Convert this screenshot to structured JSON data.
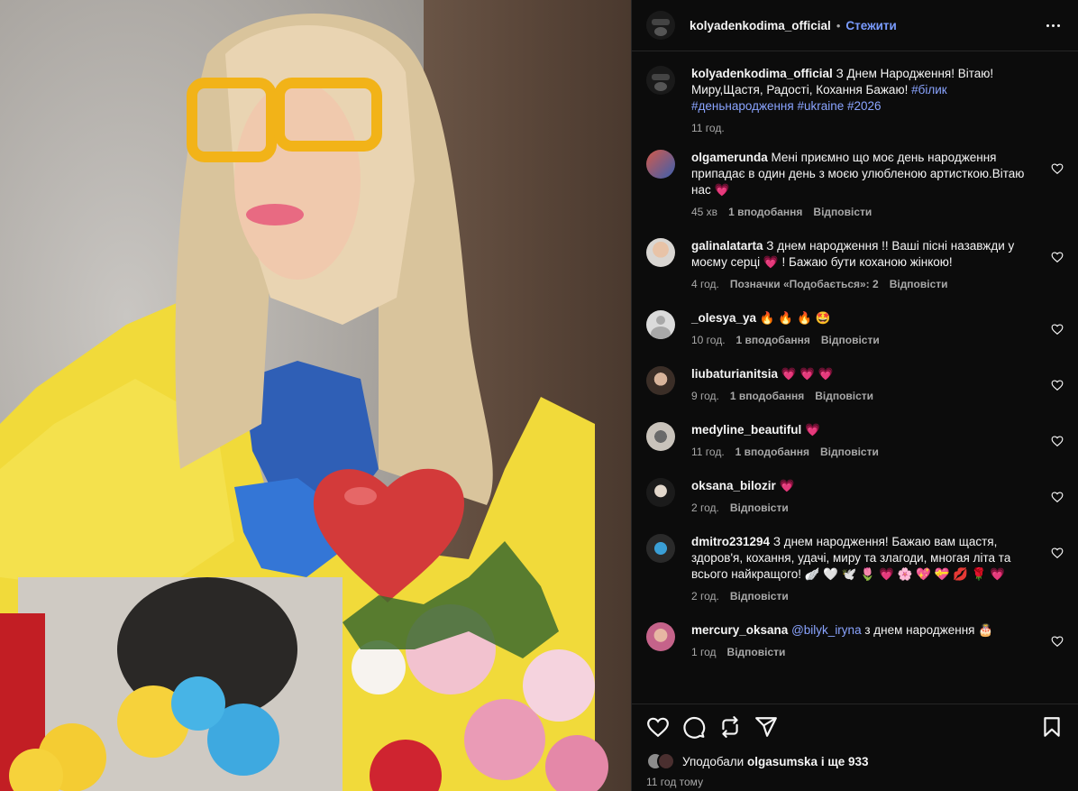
{
  "post": {
    "author": "kolyadenkodima_official",
    "follow_label": "Стежити",
    "dot": "•",
    "caption_text": "З Днем Народження! Вітаю! Миру,Щастя, Радості, Кохання Бажаю!",
    "caption_tags": "#білик #деньнародження #ukraine #2026",
    "caption_time": "11 год."
  },
  "comments": [
    {
      "user": "olgamerunda",
      "text": "Мені приємно що моє день народження припадає в один день з моєю улюбленою артисткою.Вітаю нас",
      "emoji": "💗",
      "time": "45 хв",
      "likes": "1 вподобання",
      "reply": "Відповісти"
    },
    {
      "user": "galinalatarta",
      "text": "З днем народження !! Ваші пісні назавжди у моєму серці",
      "emoji": "💗",
      "text_after": "! Бажаю бути коханою жінкою!",
      "time": "4 год.",
      "likes": "Позначки «Подобається»: 2",
      "reply": "Відповісти"
    },
    {
      "user": "_olesya_ya",
      "text": "",
      "emoji": "🔥 🔥 🔥 🤩",
      "time": "10 год.",
      "likes": "1 вподобання",
      "reply": "Відповісти"
    },
    {
      "user": "liubaturianitsia",
      "text": "",
      "emoji": "💗 💗 💗",
      "time": "9 год.",
      "likes": "1 вподобання",
      "reply": "Відповісти"
    },
    {
      "user": "medyline_beautiful",
      "text": "",
      "emoji": "💗",
      "time": "11 год.",
      "likes": "1 вподобання",
      "reply": "Відповісти"
    },
    {
      "user": "oksana_bilozir",
      "text": "",
      "emoji": "💗",
      "time": "2 год.",
      "likes": "",
      "reply": "Відповісти"
    },
    {
      "user": "dmitro231294",
      "text": "З днем народження! Бажаю вам щастя, здоров'я, кохання, удачі, миру та злагоди, многая літа та всього найкращого!",
      "emoji": "🪽 🤍 🕊️ 🌷 💗 🌸 💖 💝 💋 🌹 💗",
      "time": "2 год.",
      "likes": "",
      "reply": "Відповісти"
    },
    {
      "user": "mercury_oksana",
      "mention": "@bilyk_iryna",
      "text": "з днем народження",
      "emoji": "🎂",
      "time": "1 год",
      "likes": "",
      "reply": "Відповісти"
    }
  ],
  "footer": {
    "liked_prefix": "Уподобали",
    "liked_user": "olgasumska",
    "liked_suffix": "і ще 933",
    "posted_ago": "11 год тому"
  },
  "icons": {
    "like": "heart-icon",
    "comment": "comment-icon",
    "share": "repost-icon",
    "send": "send-icon",
    "save": "bookmark-icon",
    "more": "more-icon"
  },
  "colors": {
    "accent": "#7a9cff",
    "tag": "#8aa4ff",
    "heart": "#ff3b6b",
    "background": "#0c0c0c"
  }
}
